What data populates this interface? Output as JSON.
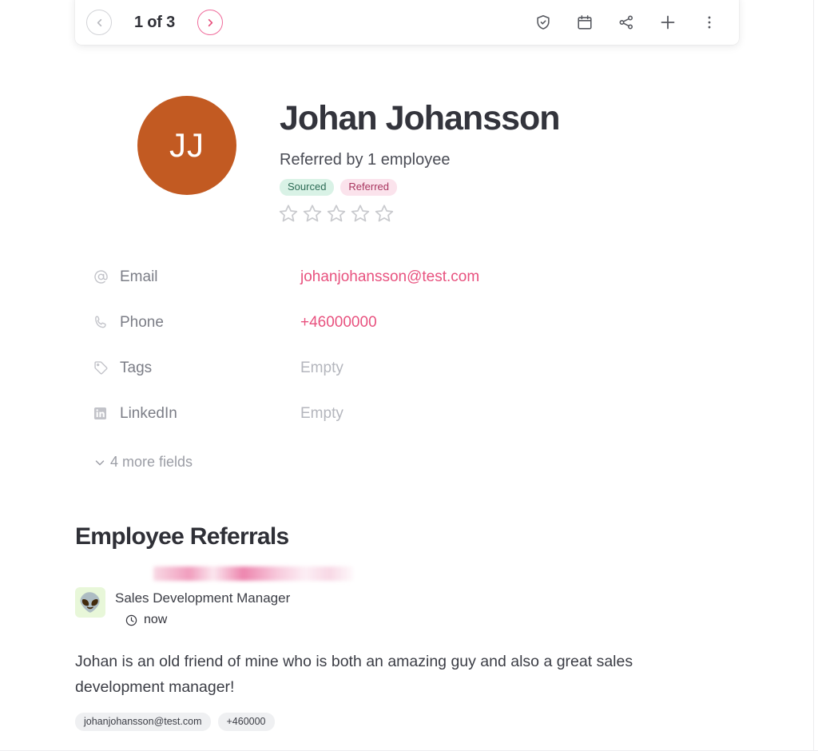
{
  "toolbar": {
    "prev_label": "previous",
    "next_label": "next",
    "counter": "1 of 3",
    "actions": [
      {
        "name": "shield-check-icon",
        "label": "Verify"
      },
      {
        "name": "calendar-icon",
        "label": "Schedule"
      },
      {
        "name": "share-icon",
        "label": "Share"
      },
      {
        "name": "plus-icon",
        "label": "Add"
      },
      {
        "name": "more-vertical-icon",
        "label": "More"
      }
    ]
  },
  "profile": {
    "avatar_initials": "JJ",
    "avatar_color": "#c25a22",
    "name": "Johan Johansson",
    "subtitle": "Referred by 1 employee",
    "badges": [
      {
        "label": "Sourced",
        "bg": "#d9f2e6",
        "fg": "#2c6b55"
      },
      {
        "label": "Referred",
        "bg": "#fbe3ec",
        "fg": "#a8345e"
      }
    ],
    "rating": {
      "value": 0,
      "max": 5
    }
  },
  "fields": {
    "rows": [
      {
        "icon": "at-icon",
        "label": "Email",
        "value": "johanjohansson@test.com",
        "style": "link"
      },
      {
        "icon": "phone-icon",
        "label": "Phone",
        "value": "+46000000",
        "style": "link"
      },
      {
        "icon": "tag-icon",
        "label": "Tags",
        "value": "Empty",
        "style": "empty"
      },
      {
        "icon": "linkedin-icon",
        "label": "LinkedIn",
        "value": "Empty",
        "style": "empty"
      }
    ],
    "more_fields_label": "4 more fields"
  },
  "referrals": {
    "section_title": "Employee Referrals",
    "referrer": {
      "avatar_emoji": "👽",
      "name_redacted": true,
      "title": "Sales Development Manager",
      "time": "now"
    },
    "message": "Johan is an old friend of mine who is both an amazing guy and also a great sales development manager!",
    "chips": [
      "johanjohansson@test.com",
      "+460000"
    ]
  },
  "colors": {
    "accent_pink": "#e8527f",
    "text_dark": "#33343c",
    "text_muted": "#7b7d86"
  }
}
